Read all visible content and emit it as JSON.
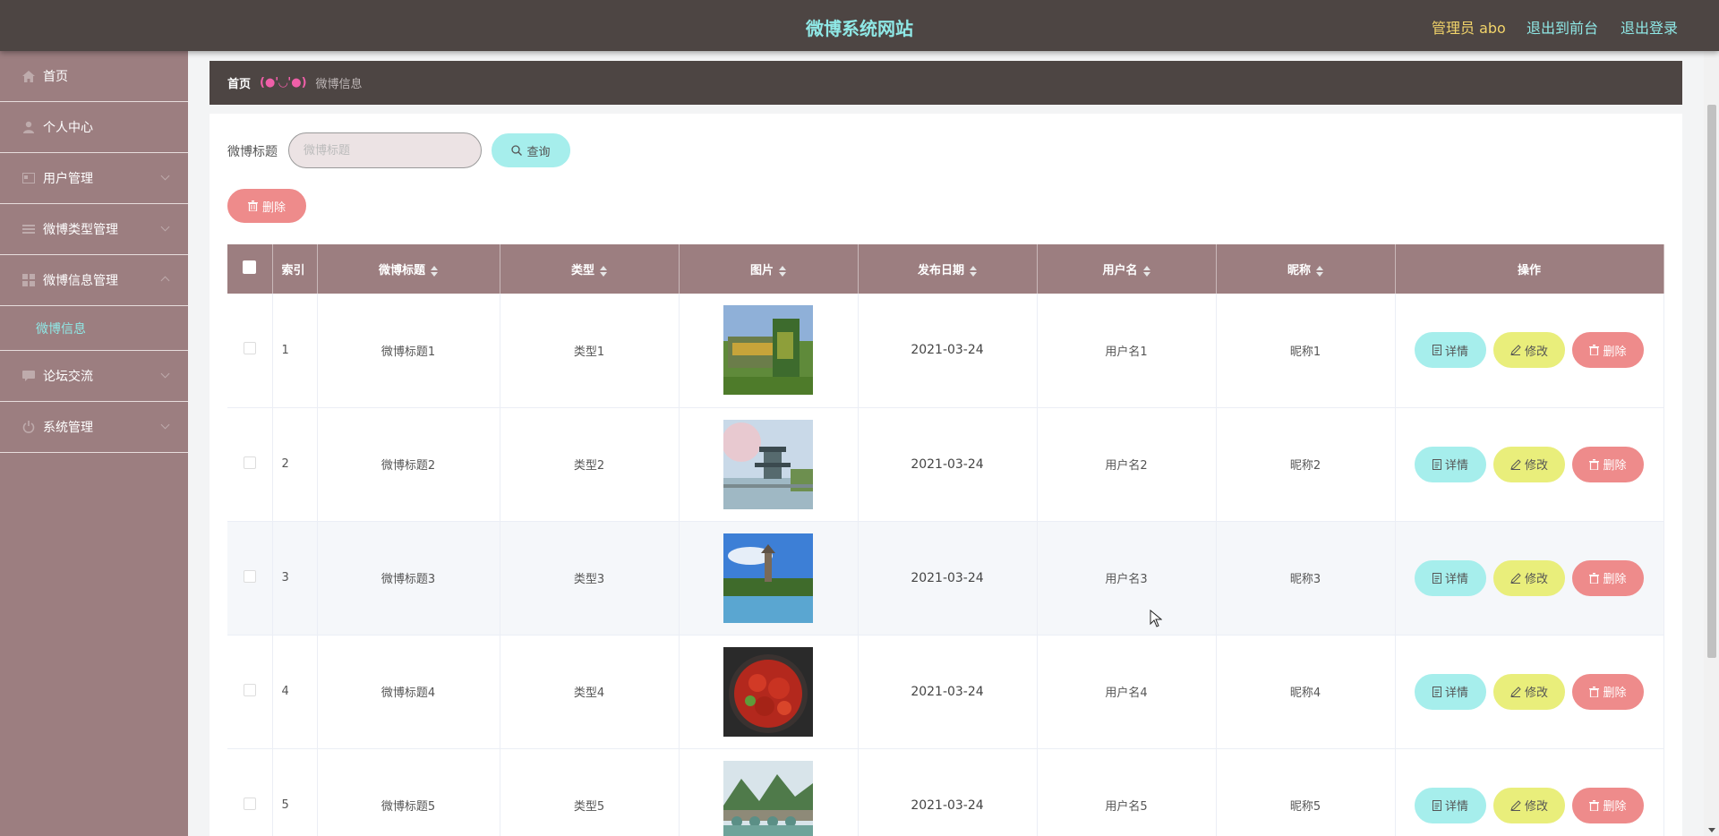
{
  "header": {
    "title": "微博系统网站",
    "admin": "管理员 abo",
    "to_front": "退出到前台",
    "logout": "退出登录"
  },
  "sidebar": {
    "items": [
      {
        "label": "首页",
        "icon": "home-icon"
      },
      {
        "label": "个人中心",
        "icon": "user-icon"
      },
      {
        "label": "用户管理",
        "icon": "users-icon"
      },
      {
        "label": "微博类型管理",
        "icon": "list-icon"
      },
      {
        "label": "微博信息管理",
        "icon": "grid-icon"
      },
      {
        "label": "论坛交流",
        "icon": "chat-icon"
      },
      {
        "label": "系统管理",
        "icon": "power-icon"
      }
    ],
    "sub_active": "微博信息"
  },
  "breadcrumb": {
    "home": "首页",
    "emoji": "(●'◡'●)",
    "current": "微博信息"
  },
  "search": {
    "label": "微博标题",
    "placeholder": "微博标题",
    "button": "查询"
  },
  "toolbar": {
    "delete": "删除"
  },
  "table": {
    "columns": [
      "索引",
      "微博标题",
      "类型",
      "图片",
      "发布日期",
      "用户名",
      "昵称",
      "操作"
    ],
    "rows": [
      {
        "index": "1",
        "title": "微博标题1",
        "type": "类型1",
        "image": "park-photo",
        "date": "2021-03-24",
        "username": "用户名1",
        "nickname": "昵称1"
      },
      {
        "index": "2",
        "title": "微博标题2",
        "type": "类型2",
        "image": "pavilion-photo",
        "date": "2021-03-24",
        "username": "用户名2",
        "nickname": "昵称2"
      },
      {
        "index": "3",
        "title": "微博标题3",
        "type": "类型3",
        "image": "lake-pagoda-photo",
        "date": "2021-03-24",
        "username": "用户名3",
        "nickname": "昵称3"
      },
      {
        "index": "4",
        "title": "微博标题4",
        "type": "类型4",
        "image": "crayfish-photo",
        "date": "2021-03-24",
        "username": "用户名4",
        "nickname": "昵称4"
      },
      {
        "index": "5",
        "title": "微博标题5",
        "type": "类型5",
        "image": "bridge-photo",
        "date": "2021-03-24",
        "username": "用户名5",
        "nickname": "昵称5"
      }
    ],
    "ops": {
      "detail": "详情",
      "edit": "修改",
      "delete": "删除"
    }
  },
  "colors": {
    "header_bg": "#4d4543",
    "sidebar_bg": "#9c7e80",
    "accent_cyan": "#8fe8e6",
    "admin_yellow": "#f2d46a",
    "btn_detail": "#a6eeec",
    "btn_edit": "#e9ee7b",
    "btn_delete": "#ee8b8b"
  }
}
